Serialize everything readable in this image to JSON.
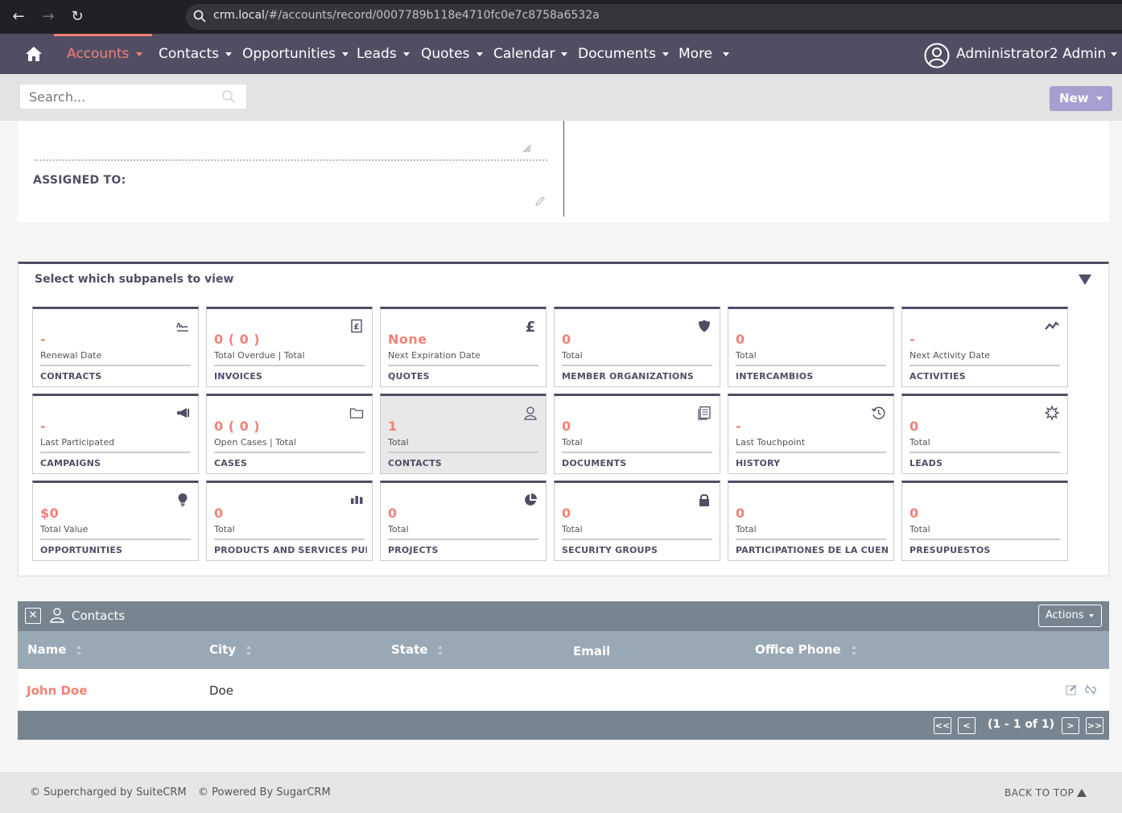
{
  "browser": {
    "url_host": "crm.local",
    "url_path": "/#/accounts/record/0007789b118e4710fc0e7c8758a6532a"
  },
  "nav": {
    "items": [
      {
        "label": "Accounts"
      },
      {
        "label": "Contacts"
      },
      {
        "label": "Opportunities"
      },
      {
        "label": "Leads"
      },
      {
        "label": "Quotes"
      },
      {
        "label": "Calendar"
      },
      {
        "label": "Documents"
      },
      {
        "label": "More"
      }
    ],
    "active": "Accounts",
    "user": "Administrator2 Admin"
  },
  "search": {
    "placeholder": "Search...",
    "new_label": "New"
  },
  "detail": {
    "assigned_label": "ASSIGNED TO:"
  },
  "subpanels": {
    "title": "Select which subpanels to view",
    "tiles": [
      {
        "value": "-",
        "sub": "Renewal Date",
        "name": "CONTRACTS",
        "icon": "signature-icon"
      },
      {
        "value": "0 ( 0 )",
        "sub": "Total Overdue | Total",
        "name": "INVOICES",
        "icon": "invoice-icon"
      },
      {
        "value": "None",
        "sub": "Next Expiration Date",
        "name": "QUOTES",
        "icon": "pound-icon"
      },
      {
        "value": "0",
        "sub": "Total",
        "name": "MEMBER ORGANIZATIONS",
        "icon": "shield-icon"
      },
      {
        "value": "0",
        "sub": "Total",
        "name": "INTERCAMBIOS",
        "icon": ""
      },
      {
        "value": "-",
        "sub": "Next Activity Date",
        "name": "ACTIVITIES",
        "icon": "activity-icon"
      },
      {
        "value": "-",
        "sub": "Last Participated",
        "name": "CAMPAIGNS",
        "icon": "megaphone-icon"
      },
      {
        "value": "0 ( 0 )",
        "sub": "Open Cases | Total",
        "name": "CASES",
        "icon": "folder-icon"
      },
      {
        "value": "1",
        "sub": "Total",
        "name": "CONTACTS",
        "icon": "person-icon"
      },
      {
        "value": "0",
        "sub": "Total",
        "name": "DOCUMENTS",
        "icon": "document-icon"
      },
      {
        "value": "-",
        "sub": "Last Touchpoint",
        "name": "HISTORY",
        "icon": "history-icon"
      },
      {
        "value": "0",
        "sub": "Total",
        "name": "LEADS",
        "icon": "starburst-icon"
      },
      {
        "value": "$0",
        "sub": "Total Value",
        "name": "OPPORTUNITIES",
        "icon": "lightbulb-icon"
      },
      {
        "value": "0",
        "sub": "Total",
        "name": "PRODUCTS AND SERVICES PUR...",
        "icon": "bar-chart-icon"
      },
      {
        "value": "0",
        "sub": "Total",
        "name": "PROJECTS",
        "icon": "pie-chart-icon"
      },
      {
        "value": "0",
        "sub": "Total",
        "name": "SECURITY GROUPS",
        "icon": "lock-icon"
      },
      {
        "value": "0",
        "sub": "Total",
        "name": "PARTICIPATIONES DE LA CUENTA",
        "icon": ""
      },
      {
        "value": "0",
        "sub": "Total",
        "name": "PRESUPUESTOS",
        "icon": ""
      }
    ],
    "selected": "CONTACTS"
  },
  "contacts": {
    "title": "Contacts",
    "actions_label": "Actions",
    "columns": [
      "Name",
      "City",
      "State",
      "Email",
      "Office Phone"
    ],
    "rows": [
      {
        "name": "John Doe",
        "city": "Doe",
        "state": "",
        "email": "",
        "phone": ""
      }
    ],
    "pagination": {
      "first": "<<",
      "prev": "<",
      "info": "(1 - 1 of 1)",
      "next": ">",
      "last": ">>"
    }
  },
  "footer": {
    "supercharged": "© Supercharged by SuiteCRM",
    "powered": "© Powered By SugarCRM",
    "back_to_top": "BACK TO TOP"
  },
  "colors": {
    "nav_bg": "#534d64",
    "accent": "#f08377",
    "new_button": "#a5a0d0",
    "subpanel_header": "#778591",
    "table_header": "#99a8b5"
  }
}
